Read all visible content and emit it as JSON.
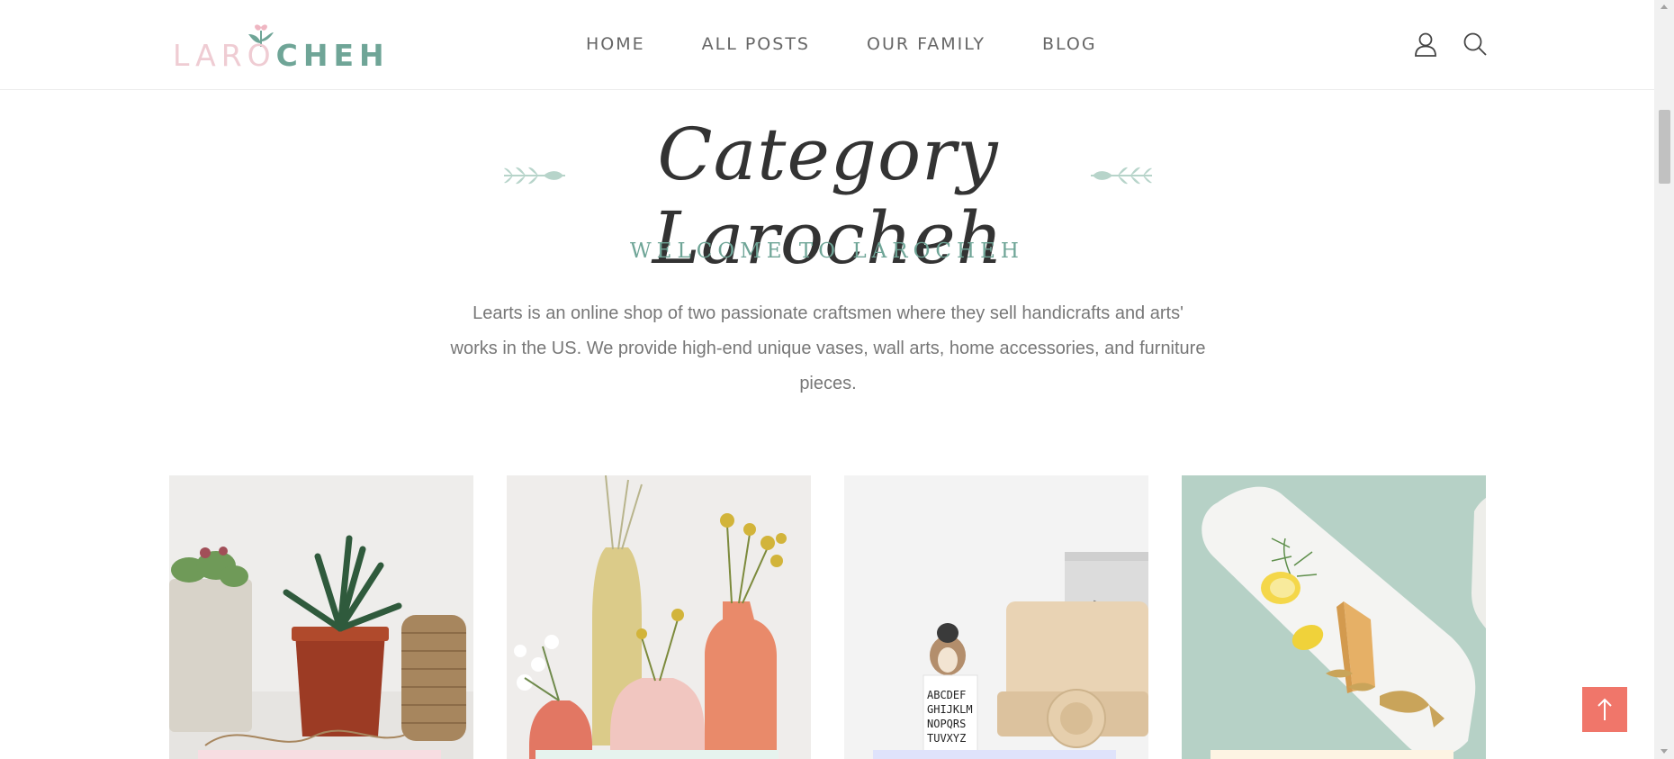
{
  "header": {
    "logo": {
      "part1": "LARO",
      "part2": "CHEH"
    },
    "nav": [
      {
        "label": "HOME"
      },
      {
        "label": "ALL POSTS"
      },
      {
        "label": "OUR FAMILY"
      },
      {
        "label": "BLOG"
      }
    ],
    "icons": {
      "user": "user-icon",
      "search": "search-icon"
    }
  },
  "hero": {
    "title": "Category Larocheh",
    "subtitle": "WELCOME TO LAROCHEH",
    "description": "Learts is an online shop of two passionate craftsmen where they sell handicrafts and arts' works in the US. We provide high-end unique vases, wall arts, home accessories, and furniture pieces."
  },
  "cards": [
    {
      "image": "succulents-and-twine"
    },
    {
      "image": "pastel-vases"
    },
    {
      "image": "wooden-toys"
    },
    {
      "image": "marble-board-lemon"
    }
  ],
  "colors": {
    "accent_green": "#6fa597",
    "accent_pink": "#efccd3",
    "back_to_top": "#f0766a",
    "text_dark": "#333333"
  },
  "back_to_top": {
    "icon": "arrow-up-icon"
  }
}
